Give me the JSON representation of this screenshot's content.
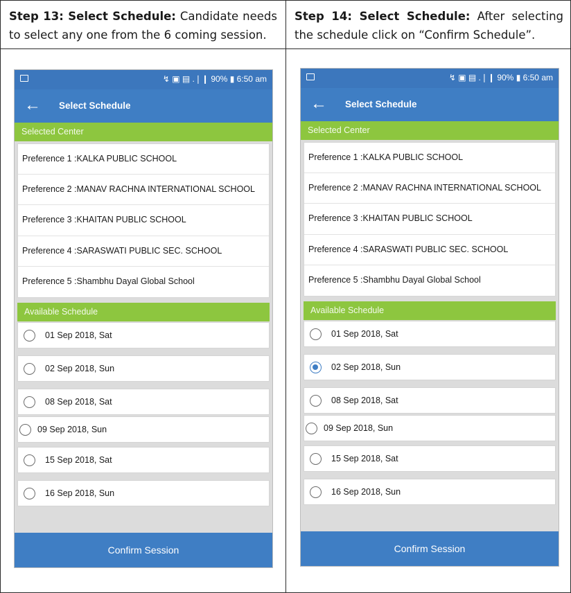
{
  "steps": [
    {
      "caption_bold": "Step 13: Select Schedule:",
      "caption_text": " Candidate needs to select any one from the 6 coming session.",
      "status_right": "↯ ▣ ▤ .❘❙ 90% ▮ 6:50 am",
      "appbar_title": "Select Schedule",
      "selected_center_header": "Selected Center",
      "preferences": [
        "Preference 1 :KALKA PUBLIC SCHOOL",
        "Preference 2 :MANAV RACHNA INTERNATIONAL SCHOOL",
        "Preference 3 :KHAITAN PUBLIC SCHOOL",
        "Preference 4 :SARASWATI PUBLIC SEC. SCHOOL",
        "Preference 5 :Shambhu Dayal Global School"
      ],
      "available_schedule_header": "Available Schedule",
      "schedules": [
        {
          "label": "01 Sep 2018, Sat",
          "selected": false
        },
        {
          "label": "02 Sep 2018, Sun",
          "selected": false
        },
        {
          "label": "08 Sep 2018, Sat",
          "selected": false
        },
        {
          "label": "09 Sep 2018, Sun",
          "selected": false
        },
        {
          "label": "15 Sep 2018, Sat",
          "selected": false
        },
        {
          "label": "16 Sep 2018, Sun",
          "selected": false
        }
      ],
      "confirm_label": "Confirm Session"
    },
    {
      "caption_bold": "Step 14: Select Schedule:",
      "caption_text": " After selecting the schedule click on “Confirm Schedule”.",
      "status_right": "↯ ▣ ▤ .❘❙ 90% ▮ 6:50 am",
      "appbar_title": "Select Schedule",
      "selected_center_header": "Selected Center",
      "preferences": [
        "Preference 1 :KALKA PUBLIC SCHOOL",
        "Preference 2 :MANAV RACHNA INTERNATIONAL SCHOOL",
        "Preference 3 :KHAITAN PUBLIC SCHOOL",
        "Preference 4 :SARASWATI PUBLIC SEC. SCHOOL",
        "Preference 5 :Shambhu Dayal Global School"
      ],
      "available_schedule_header": "Available Schedule",
      "schedules": [
        {
          "label": "01 Sep 2018, Sat",
          "selected": false
        },
        {
          "label": "02 Sep 2018, Sun",
          "selected": true
        },
        {
          "label": "08 Sep 2018, Sat",
          "selected": false
        },
        {
          "label": "09 Sep 2018, Sun",
          "selected": false
        },
        {
          "label": "15 Sep 2018, Sat",
          "selected": false
        },
        {
          "label": "16 Sep 2018, Sun",
          "selected": false
        }
      ],
      "confirm_label": "Confirm Session"
    }
  ],
  "colors": {
    "primary_blue": "#3f7ec4",
    "section_green": "#8dc63f",
    "background_gray": "#dcdcdc"
  }
}
